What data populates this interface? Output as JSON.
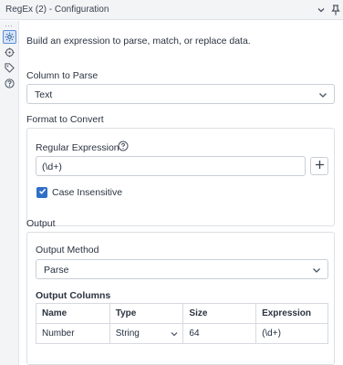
{
  "window": {
    "title": "RegEx (2) - Configuration"
  },
  "description": "Build an expression to parse, match, or replace data.",
  "column_to_parse": {
    "label": "Column to Parse",
    "value": "Text"
  },
  "format_to_convert": {
    "label": "Format to Convert",
    "regex_label": "Regular Expression",
    "regex_value": "(\\d+)",
    "case_insensitive_label": "Case Insensitive",
    "case_insensitive_checked": true
  },
  "output": {
    "label": "Output",
    "method_label": "Output Method",
    "method_value": "Parse",
    "columns_label": "Output Columns",
    "table": {
      "headers": [
        "Name",
        "Type",
        "Size",
        "Expression"
      ],
      "rows": [
        {
          "name": "Number",
          "type": "String",
          "size": "64",
          "expression": "(\\d+)"
        }
      ]
    }
  },
  "colors": {
    "accent": "#2f6fc7",
    "rail_bg": "#f3f4f6"
  },
  "icons": [
    "chevron-down-icon",
    "pin-icon",
    "gear-icon",
    "crosshair-icon",
    "tag-icon",
    "help-icon",
    "info-icon",
    "plus-icon",
    "check-icon"
  ]
}
